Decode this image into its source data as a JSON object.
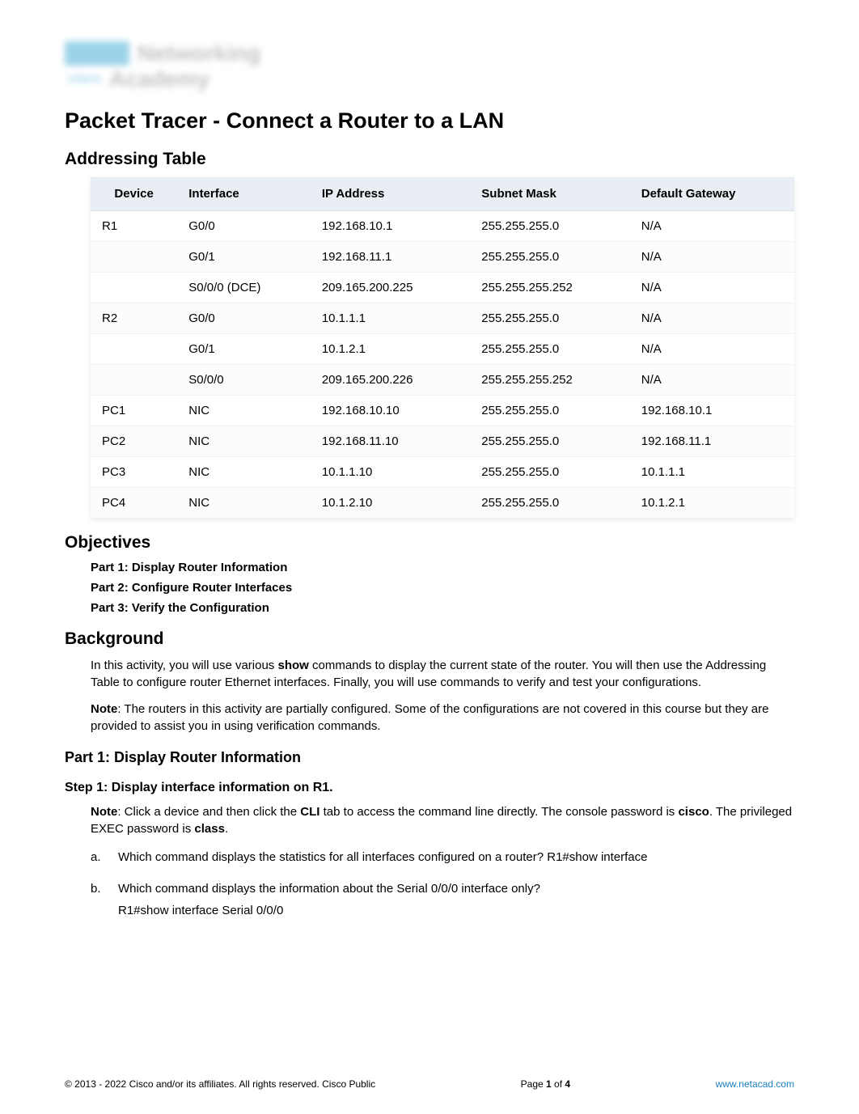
{
  "logo": {
    "brand": "cisco",
    "line1": "Networking",
    "line2": "Academy"
  },
  "title": "Packet Tracer - Connect a Router to a LAN",
  "sections": {
    "addressing_table": {
      "heading": "Addressing Table",
      "columns": [
        "Device",
        "Interface",
        "IP Address",
        "Subnet Mask",
        "Default Gateway"
      ],
      "rows": [
        {
          "device": "R1",
          "interface": "G0/0",
          "ip": "192.168.10.1",
          "mask": "255.255.255.0",
          "gw": "N/A"
        },
        {
          "device": "",
          "interface": "G0/1",
          "ip": "192.168.11.1",
          "mask": "255.255.255.0",
          "gw": "N/A"
        },
        {
          "device": "",
          "interface": "S0/0/0 (DCE)",
          "ip": "209.165.200.225",
          "mask": "255.255.255.252",
          "gw": "N/A"
        },
        {
          "device": "R2",
          "interface": "G0/0",
          "ip": "10.1.1.1",
          "mask": "255.255.255.0",
          "gw": "N/A"
        },
        {
          "device": "",
          "interface": "G0/1",
          "ip": "10.1.2.1",
          "mask": "255.255.255.0",
          "gw": "N/A"
        },
        {
          "device": "",
          "interface": "S0/0/0",
          "ip": "209.165.200.226",
          "mask": "255.255.255.252",
          "gw": "N/A"
        },
        {
          "device": "PC1",
          "interface": "NIC",
          "ip": "192.168.10.10",
          "mask": "255.255.255.0",
          "gw": "192.168.10.1"
        },
        {
          "device": "PC2",
          "interface": "NIC",
          "ip": "192.168.11.10",
          "mask": "255.255.255.0",
          "gw": "192.168.11.1"
        },
        {
          "device": "PC3",
          "interface": "NIC",
          "ip": "10.1.1.10",
          "mask": "255.255.255.0",
          "gw": "10.1.1.1"
        },
        {
          "device": "PC4",
          "interface": "NIC",
          "ip": "10.1.2.10",
          "mask": "255.255.255.0",
          "gw": "10.1.2.1"
        }
      ]
    },
    "objectives": {
      "heading": "Objectives",
      "items": [
        "Part 1: Display Router Information",
        "Part 2: Configure Router Interfaces",
        "Part 3: Verify the Configuration"
      ]
    },
    "background": {
      "heading": "Background",
      "para1_prefix": "In this activity, you will use various ",
      "para1_bold": "show",
      "para1_suffix": " commands to display the current state of the router. You will then use the Addressing Table to configure router Ethernet interfaces. Finally, you will use commands to verify and test your configurations.",
      "note_label": "Note",
      "note_text": ": The routers in this activity are partially configured. Some of the configurations are not covered in this course but they are provided to assist you in using verification commands."
    },
    "part1": {
      "heading": "Part 1: Display Router Information",
      "step1_heading": "Step 1: Display interface information on R1.",
      "step1_note_label": "Note",
      "step1_note_prefix": ": Click a device and then click the ",
      "step1_note_bold1": "CLI",
      "step1_note_mid": " tab to access the command line directly. The console password is ",
      "step1_note_bold2": "cisco",
      "step1_note_mid2": ". The privileged EXEC password is ",
      "step1_note_bold3": "class",
      "step1_note_suffix": ".",
      "qa": {
        "a_letter": "a.",
        "a_question": "Which command displays the statistics for all interfaces configured on a router?  R1#show interface",
        "b_letter": "b.",
        "b_question": "Which command displays the information about the Serial 0/0/0 interface only?",
        "b_answer": "R1#show interface Serial 0/0/0"
      }
    }
  },
  "footer": {
    "copyright_symbol": "©",
    "copyright": " 2013 - 2022 Cisco and/or its affiliates. All rights reserved. Cisco Public",
    "page_prefix": "Page ",
    "page_current": "1",
    "page_of": " of ",
    "page_total": "4",
    "link": "www.netacad.com"
  }
}
